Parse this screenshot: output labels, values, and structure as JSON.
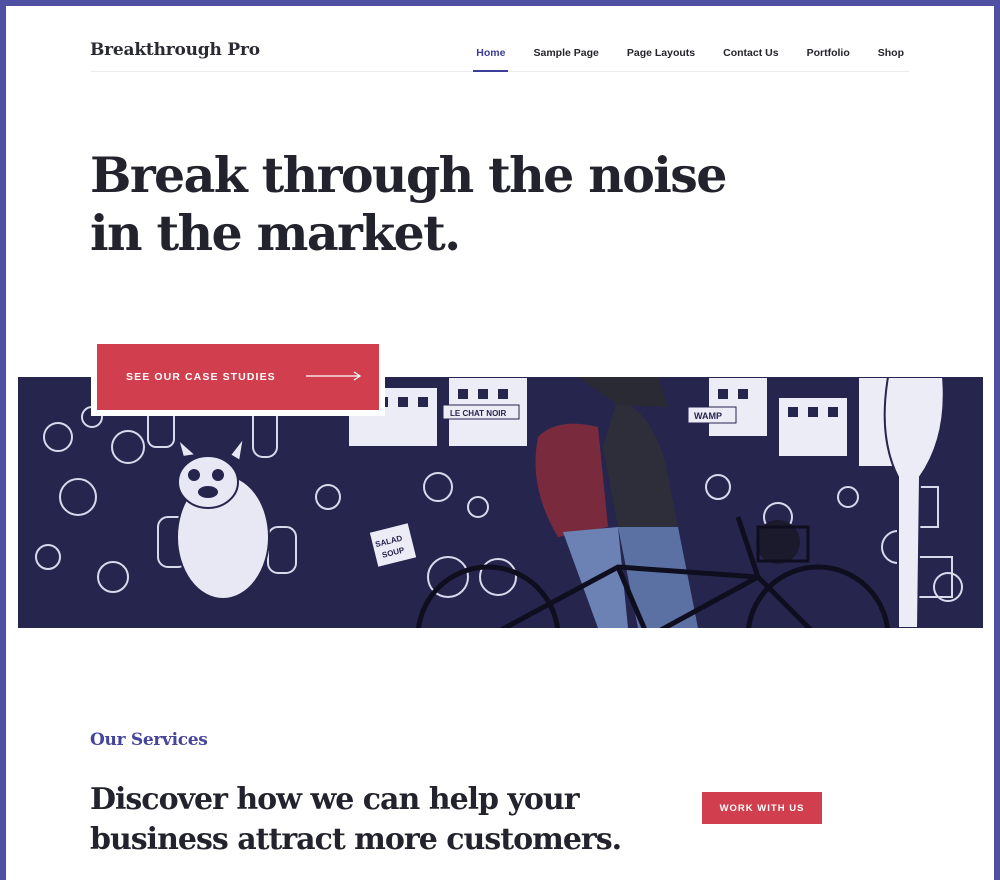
{
  "site": {
    "title": "Breakthrough Pro"
  },
  "nav": {
    "items": [
      {
        "label": "Home",
        "active": true
      },
      {
        "label": "Sample Page",
        "active": false
      },
      {
        "label": "Page Layouts",
        "active": false
      },
      {
        "label": "Contact Us",
        "active": false
      },
      {
        "label": "Portfolio",
        "active": false
      },
      {
        "label": "Shop",
        "active": false
      }
    ]
  },
  "hero": {
    "title_line1": "Break through the noise",
    "title_line2": "in the market.",
    "cta_label": "SEE OUR CASE STUDIES",
    "cta_icon": "arrow-right-icon",
    "image_subject": "graffiti-mural-cyclist-photo"
  },
  "services": {
    "label": "Our Services",
    "title_line1": "Discover how we can help your",
    "title_line2": "business attract more customers.",
    "button_label": "WORK WITH US"
  },
  "colors": {
    "accent": "#d13f4e",
    "brand": "#3d3d9a",
    "frame": "#4f4fa3",
    "text": "#23232d",
    "image_tint": "#24244c"
  }
}
